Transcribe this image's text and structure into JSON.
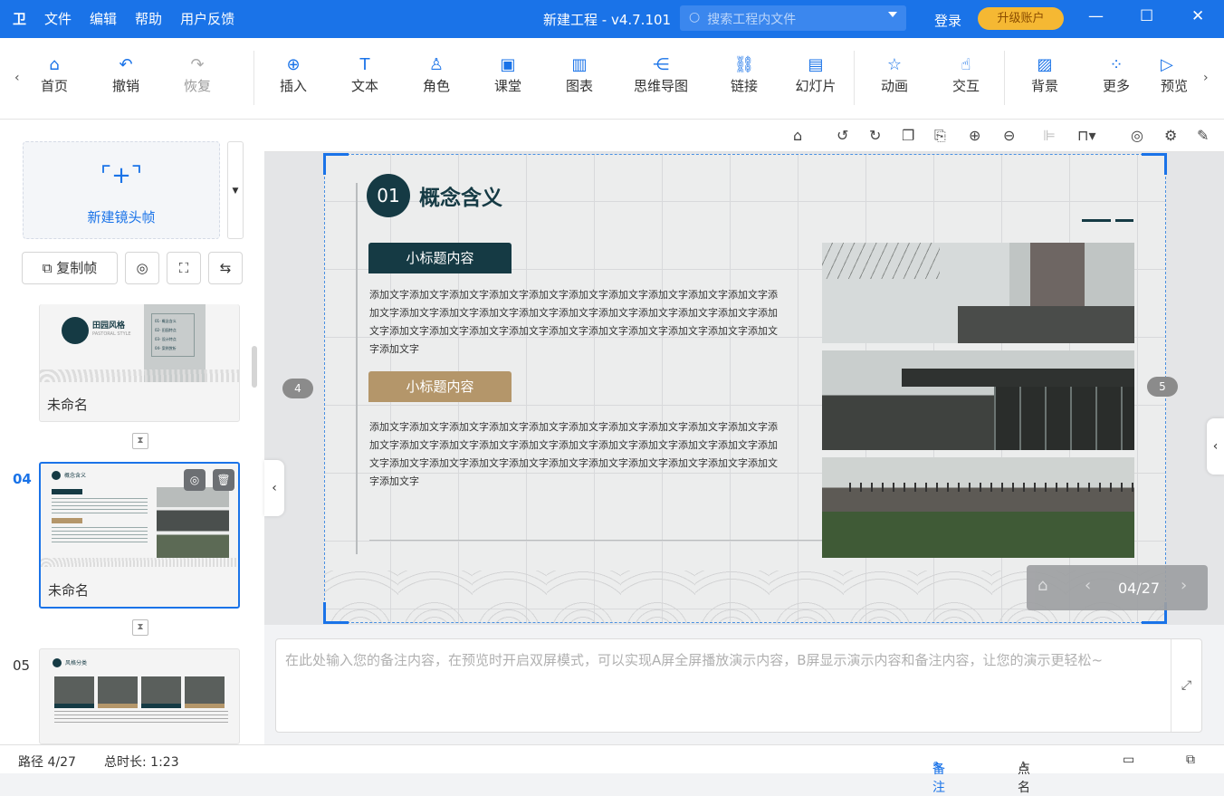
{
  "titlebar": {
    "logo": "卫",
    "menu": [
      "文件",
      "编辑",
      "帮助",
      "用户反馈"
    ],
    "title": "新建工程 - v4.7.101",
    "search_placeholder": "搜索工程内文件",
    "login": "登录",
    "upgrade": "升级账户"
  },
  "toolbar": {
    "items": [
      {
        "label": "首页",
        "icon": "home-icon"
      },
      {
        "label": "撤销",
        "icon": "undo-icon"
      },
      {
        "label": "恢复",
        "icon": "redo-icon"
      },
      {
        "label": "插入",
        "icon": "plus-circle-icon"
      },
      {
        "label": "文本",
        "icon": "text-icon"
      },
      {
        "label": "角色",
        "icon": "person-icon"
      },
      {
        "label": "课堂",
        "icon": "classroom-icon"
      },
      {
        "label": "图表",
        "icon": "chart-icon"
      },
      {
        "label": "思维导图",
        "icon": "mindmap-icon"
      },
      {
        "label": "链接",
        "icon": "link-icon"
      },
      {
        "label": "幻灯片",
        "icon": "slide-icon"
      },
      {
        "label": "动画",
        "icon": "star-icon"
      },
      {
        "label": "交互",
        "icon": "hand-icon"
      },
      {
        "label": "背景",
        "icon": "background-icon"
      },
      {
        "label": "更多",
        "icon": "grid-icon"
      },
      {
        "label": "预览",
        "icon": "play-icon"
      }
    ]
  },
  "left": {
    "new_frame": "新建镜头帧",
    "copy_frame": "复制帧",
    "thumbs": [
      {
        "num": "",
        "name": "未命名",
        "title": "田园风格",
        "subtitle": "PASTORAL STYLE",
        "toc": [
          "01- 概念含义",
          "02- 田园特点",
          "03- 设计特点",
          "04- 案例赏析"
        ]
      },
      {
        "num": "04",
        "name": "未命名",
        "title": "概念含义"
      },
      {
        "num": "05",
        "name": "",
        "title": "风格分类"
      }
    ]
  },
  "slide": {
    "num_circle": "01",
    "heading": "概念含义",
    "sub1": "小标题内容",
    "sub2": "小标题内容",
    "body1": "添加文字添加文字添加文字添加文字添加文字添加文字添加文字添加文字添加文字添加文字添加文字添加文字添加文字添加文字添加文字添加文字添加文字添加文字添加文字添加文字添加文字添加文字添加文字添加文字添加文字添加文字添加文字添加文字添加文字添加文字添加文字添加文字",
    "body2": "添加文字添加文字添加文字添加文字添加文字添加文字添加文字添加文字添加文字添加文字添加文字添加文字添加文字添加文字添加文字添加文字添加文字添加文字添加文字添加文字添加文字添加文字添加文字添加文字添加文字添加文字添加文字添加文字添加文字添加文字添加文字添加文字",
    "prev_badge": "4",
    "next_badge": "5",
    "page_indicator": "04/27"
  },
  "notes": {
    "placeholder": "在此处输入您的备注内容，在预览时开启双屏模式，可以实现A屏全屏播放演示内容，B屏显示演示内容和备注内容，让您的演示更轻松~"
  },
  "status": {
    "path": "路径 4/27",
    "duration": "总时长: 1:23",
    "notes_btn": "备注",
    "rollcall_btn": "点名"
  },
  "colors": {
    "brand": "#1a73e8",
    "dark_teal": "#153a44",
    "tan": "#b4966a"
  }
}
